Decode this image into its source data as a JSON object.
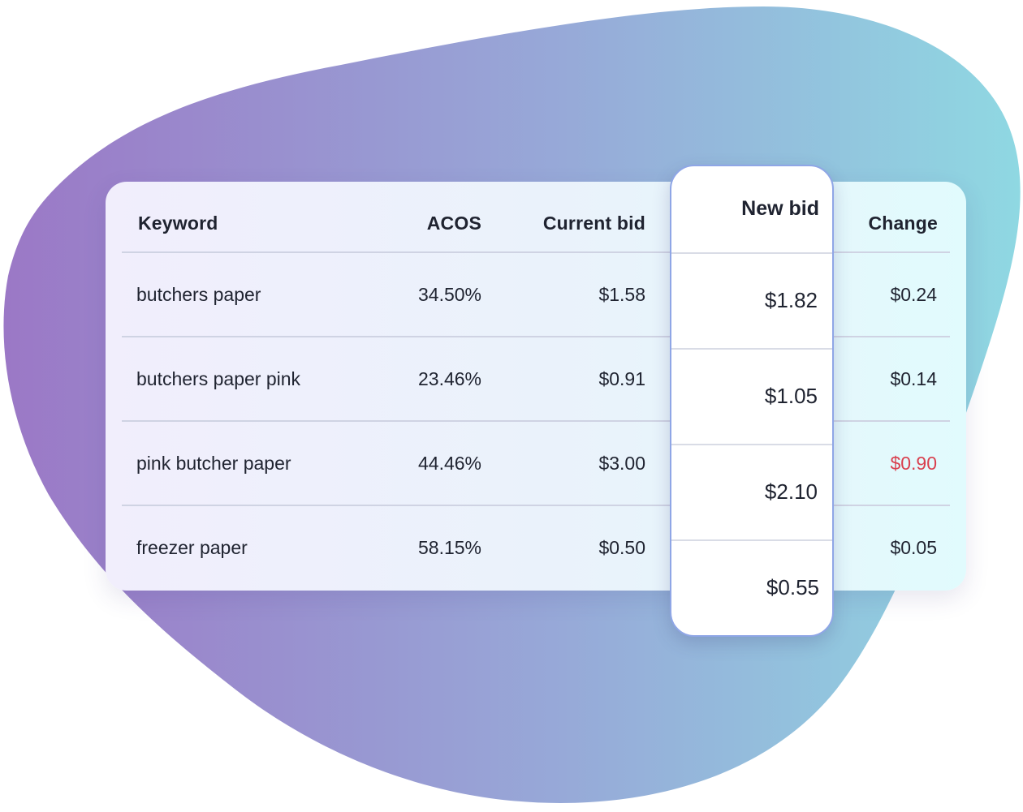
{
  "colors": {
    "blob_start": "#9b78c6",
    "blob_end": "#8fd8e2",
    "highlight_border": "#8fa6e6",
    "negative_change": "#d9404f",
    "text": "#1f2330"
  },
  "table": {
    "headers": {
      "keyword": "Keyword",
      "acos": "ACOS",
      "current_bid": "Current bid",
      "new_bid": "New bid",
      "change": "Change"
    },
    "rows": [
      {
        "keyword": "butchers paper",
        "acos": "34.50%",
        "current_bid": "$1.58",
        "new_bid": "$1.82",
        "change": "$0.24",
        "change_negative": false
      },
      {
        "keyword": "butchers paper pink",
        "acos": "23.46%",
        "current_bid": "$0.91",
        "new_bid": "$1.05",
        "change": "$0.14",
        "change_negative": false
      },
      {
        "keyword": "pink butcher paper",
        "acos": "44.46%",
        "current_bid": "$3.00",
        "new_bid": "$2.10",
        "change": "$0.90",
        "change_negative": true
      },
      {
        "keyword": "freezer paper",
        "acos": "58.15%",
        "current_bid": "$0.50",
        "new_bid": "$0.55",
        "change": "$0.05",
        "change_negative": false
      }
    ]
  }
}
